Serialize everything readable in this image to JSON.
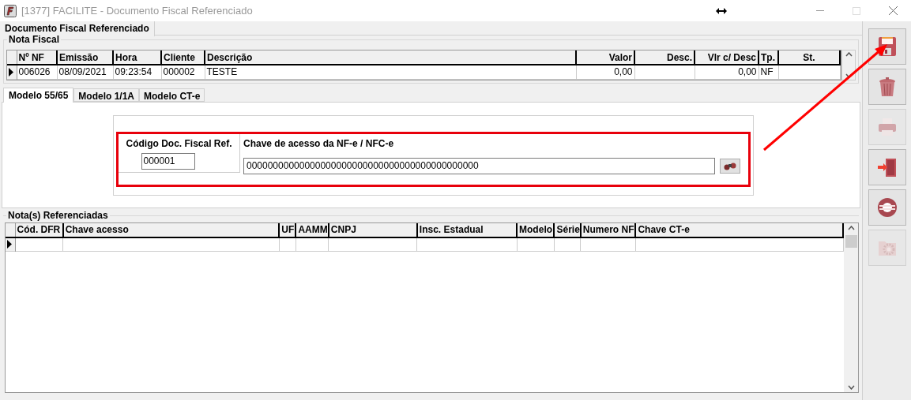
{
  "window": {
    "title": "[1377] FACILITE - Documento Fiscal Referenciado"
  },
  "main_tab": {
    "label": "Documento Fiscal Referenciado",
    "selected": true
  },
  "nota_fiscal": {
    "title": "Nota Fiscal",
    "columns": [
      "Nº NF",
      "Emissão",
      "Hora",
      "Cliente",
      "Descrição",
      "Valor",
      "Desc.",
      "Vlr c/ Desc",
      "Tp.",
      "St."
    ],
    "rows": [
      {
        "cells": [
          "006026",
          "08/09/2021",
          "09:23:54",
          "000002",
          "TESTE",
          "0,00",
          "",
          "0,00",
          "NF",
          ""
        ],
        "selected": true
      }
    ]
  },
  "model_tabs": [
    {
      "label": "Modelo 55/65",
      "selected": true
    },
    {
      "label": "Modelo 1/1A",
      "selected": false
    },
    {
      "label": "Modelo CT-e",
      "selected": false
    }
  ],
  "codigo_field": {
    "label": "Código Doc. Fiscal Ref.",
    "value": "000001"
  },
  "chave_field": {
    "label": "Chave de acesso da NF-e / NFC-e",
    "value": "00000000000000000000000000000000000000000000"
  },
  "referenciadas": {
    "title": "Nota(s) Referenciadas",
    "columns": [
      "Cód. DFR",
      "Chave acesso",
      "UF",
      "AAMM",
      "CNPJ",
      "Insc. Estadual",
      "Modelo",
      "Série",
      "Numero NF",
      "Chave CT-e"
    ],
    "rows": [
      {
        "cells": [
          "",
          "",
          "",
          "",
          "",
          "",
          "",
          "",
          "",
          ""
        ],
        "selected": true
      }
    ]
  },
  "toolbar": [
    {
      "kind": "save",
      "disabled": false
    },
    {
      "kind": "delete",
      "disabled": false
    },
    {
      "kind": "print",
      "disabled": true
    },
    {
      "kind": "exit",
      "disabled": false
    },
    {
      "kind": "help",
      "disabled": false
    },
    {
      "kind": "settings",
      "disabled": true
    }
  ]
}
